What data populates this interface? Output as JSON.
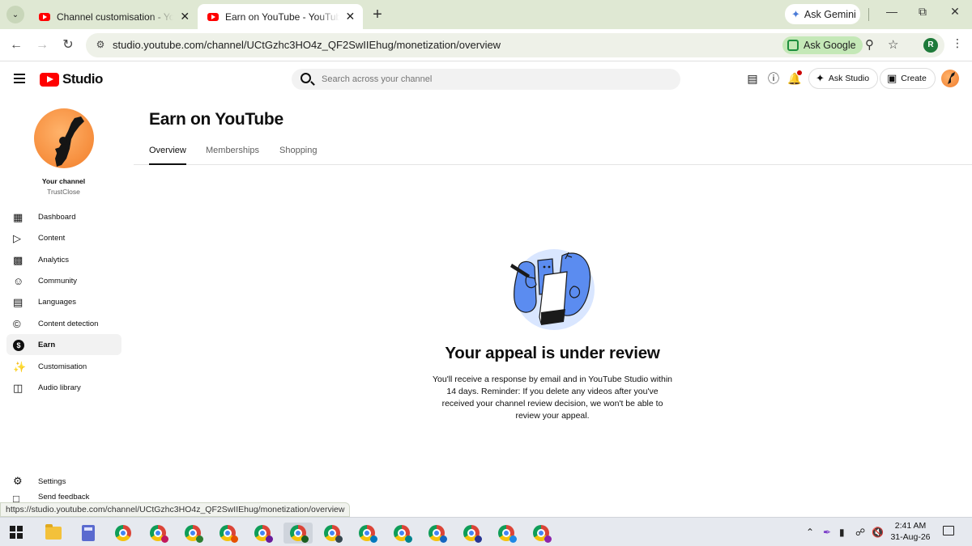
{
  "browser": {
    "tabs": [
      {
        "title": "Channel customisation - YouTube Studio",
        "active": false
      },
      {
        "title": "Earn on YouTube - YouTube Studio",
        "active": true
      }
    ],
    "ask_gemini": "Ask Gemini",
    "url": "studio.youtube.com/channel/UCtGzhc3HO4z_QF2SwIIEhug/monetization/overview",
    "ask_google": "Ask Google",
    "profile_initial": "R",
    "status_url": "https://studio.youtube.com/channel/UCtGzhc3HO4z_QF2SwIIEhug/monetization/overview"
  },
  "header": {
    "logo_text": "Studio",
    "search_placeholder": "Search across your channel",
    "ask_studio": "Ask Studio",
    "create": "Create"
  },
  "sidebar": {
    "channel_label": "Your channel",
    "channel_name": "TrustClose",
    "items": [
      {
        "label": "Dashboard",
        "icon": "dashboard-icon"
      },
      {
        "label": "Content",
        "icon": "content-icon"
      },
      {
        "label": "Analytics",
        "icon": "analytics-icon"
      },
      {
        "label": "Community",
        "icon": "community-icon"
      },
      {
        "label": "Languages",
        "icon": "languages-icon"
      },
      {
        "label": "Content detection",
        "icon": "copyright-icon"
      },
      {
        "label": "Earn",
        "icon": "dollar-icon",
        "active": true
      },
      {
        "label": "Customisation",
        "icon": "wand-icon"
      },
      {
        "label": "Audio library",
        "icon": "audio-library-icon"
      }
    ],
    "settings": "Settings",
    "feedback": "Send feedback"
  },
  "main": {
    "title": "Earn on YouTube",
    "tabs": [
      "Overview",
      "Memberships",
      "Shopping"
    ],
    "active_tab": "Overview",
    "appeal_title": "Your appeal is under review",
    "appeal_desc": "You'll receive a response by email and in YouTube Studio within 14 days. Reminder: If you delete any videos after you've received your channel review decision, we won't be able to review your appeal."
  },
  "taskbar": {
    "time": "2:41 AM",
    "date": "31-Aug-26"
  },
  "colors": {
    "youtube_red": "#ff0000",
    "tab_strip": "#dfe8d3",
    "ask_google_bg": "#c4e8b7",
    "illustration_blue": "#5b8cf0"
  }
}
